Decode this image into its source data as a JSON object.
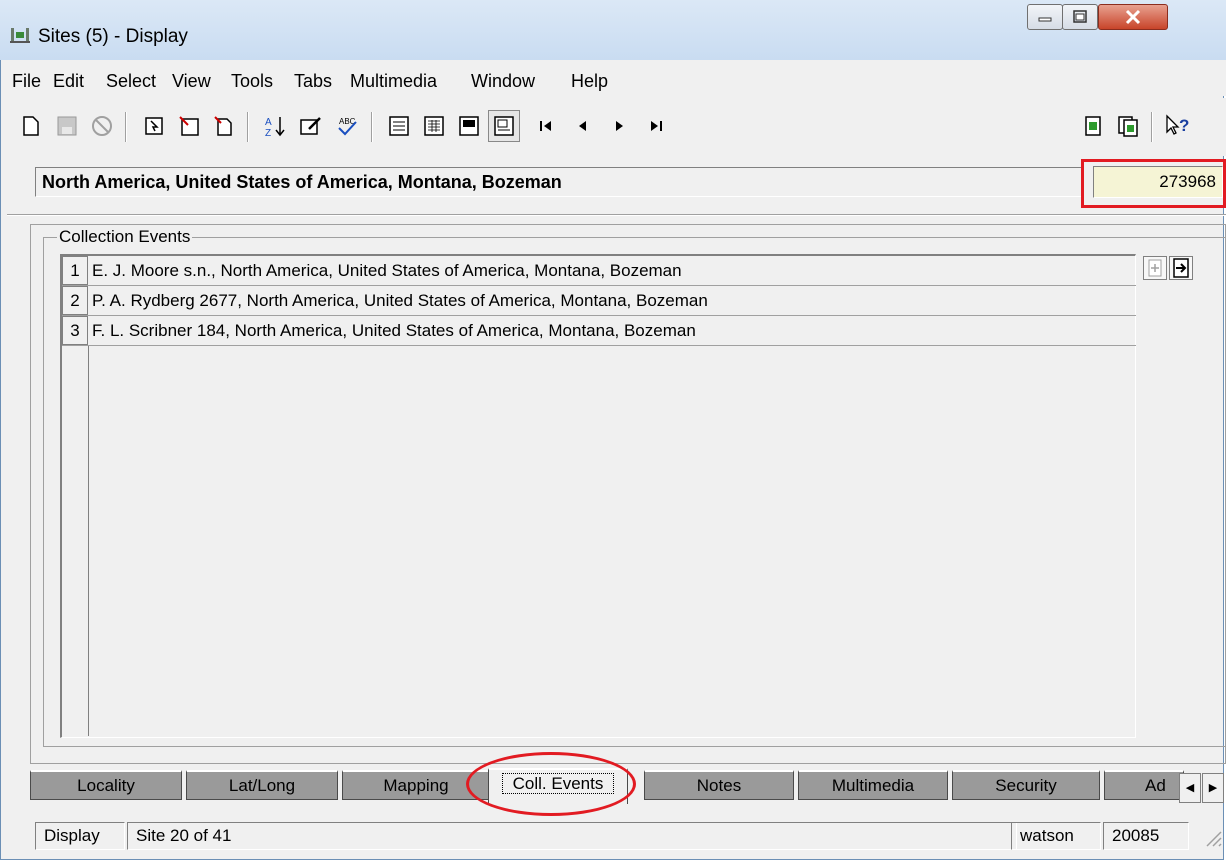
{
  "window": {
    "title": "Sites (5) - Display"
  },
  "menu": [
    "File",
    "Edit",
    "Select",
    "View",
    "Tools",
    "Tabs",
    "Multimedia",
    "Window",
    "Help"
  ],
  "header": {
    "summary": "North America, United States of America, Montana, Bozeman",
    "irn": "273968"
  },
  "group": {
    "label": "Collection Events"
  },
  "rows": [
    {
      "num": "1",
      "text": "E. J. Moore s.n., North America, United States of America, Montana, Bozeman"
    },
    {
      "num": "2",
      "text": "P. A. Rydberg 2677, North America, United States of America, Montana, Bozeman"
    },
    {
      "num": "3",
      "text": "F. L. Scribner 184, North America, United States of America, Montana, Bozeman"
    }
  ],
  "tabs": [
    {
      "label": "Locality"
    },
    {
      "label": "Lat/Long"
    },
    {
      "label": "Mapping"
    },
    {
      "label": "Coll. Events",
      "active": true
    },
    {
      "label": "Notes"
    },
    {
      "label": "Multimedia"
    },
    {
      "label": "Security"
    },
    {
      "label": "Ad"
    }
  ],
  "status": {
    "mode": "Display",
    "position": "Site 20 of 41",
    "user": "watson",
    "count": "20085"
  },
  "colors": {
    "highlight": "#e21b22",
    "irn_background": "#f5f4d5",
    "inactive_tab": "#9a9a9a"
  }
}
